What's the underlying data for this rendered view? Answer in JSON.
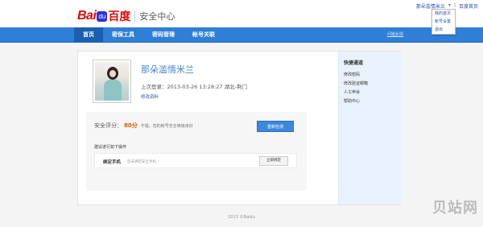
{
  "header": {
    "logo": {
      "bai": "Bai",
      "paw": "du",
      "du": "百度",
      "title": "安全中心"
    },
    "toplinks": {
      "user": "那朵滥情米兰",
      "home": "百度首页"
    },
    "dropdown": [
      "我的首页",
      "帐号设置",
      "退出"
    ]
  },
  "nav": {
    "items": [
      "首页",
      "密保工具",
      "密码管理",
      "帐号关联"
    ],
    "active_index": 0,
    "right_link": "问题反馈"
  },
  "profile": {
    "username": "那朵滥情米兰",
    "login_info": "上次登录：2013-03-26 13:28:27  湖北-荆门",
    "edit_link": "修改资料"
  },
  "security": {
    "label": "安全评分：",
    "score": "80分",
    "desc": "不错，您的帐号安全等级良好",
    "recheck_button": "重新检测",
    "advice": "建议进行如下操作",
    "task": {
      "title": "绑定手机",
      "desc": "您未绑定安全手机",
      "button": "立即绑定"
    }
  },
  "sidebar": {
    "title": "快捷通道",
    "links": [
      "修改密码",
      "修改验证邮箱",
      "人工申诉",
      "帮助中心"
    ]
  },
  "footer": "2013 ©Baidu",
  "watermark": "贝站网",
  "colors": {
    "nav_blue": "#2f7fd6",
    "nav_active": "#1b5fb3",
    "accent_link": "#2553a8",
    "score_orange": "#e25a00",
    "brand_red": "#e10601"
  }
}
